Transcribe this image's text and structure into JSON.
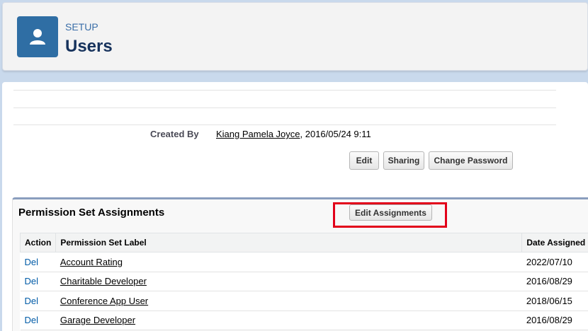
{
  "header": {
    "setup": "SETUP",
    "title": "Users",
    "icon": "user-icon"
  },
  "created": {
    "label": "Created By",
    "user": "Kiang Pamela Joyce",
    "date": ", 2016/05/24 9:11"
  },
  "buttons": {
    "edit": "Edit",
    "sharing": "Sharing",
    "change_password": "Change Password"
  },
  "psa": {
    "title": "Permission Set Assignments",
    "edit_assignments": "Edit Assignments",
    "columns": {
      "action": "Action",
      "label": "Permission Set Label",
      "date": "Date Assigned"
    },
    "rows": [
      {
        "action": "Del",
        "label": "Account Rating",
        "date": "2022/07/10"
      },
      {
        "action": "Del",
        "label": "Charitable Developer",
        "date": "2016/08/29"
      },
      {
        "action": "Del",
        "label": "Conference App User",
        "date": "2018/06/15"
      },
      {
        "action": "Del",
        "label": "Garage Developer",
        "date": "2016/08/29"
      }
    ]
  },
  "colors": {
    "accent": "#2f6ea4",
    "highlight": "#e2001a",
    "link": "#015ba7"
  }
}
